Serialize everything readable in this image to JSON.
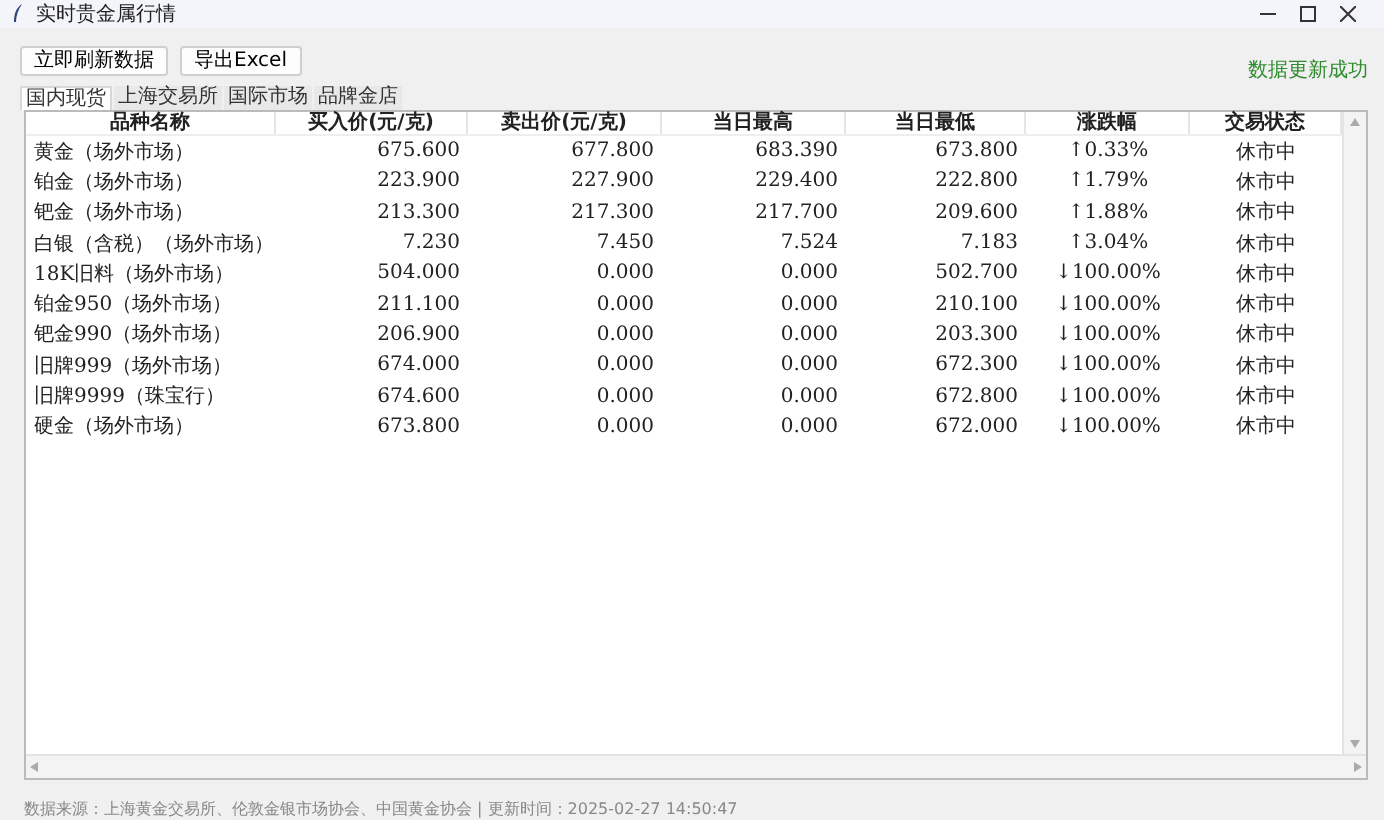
{
  "window": {
    "title": "实时贵金属行情"
  },
  "toolbar": {
    "buttons": [
      "立即刷新数据",
      "导出Excel"
    ],
    "status": "数据更新成功"
  },
  "tabs": [
    {
      "label": "国内现货",
      "selected": true
    },
    {
      "label": "上海交易所",
      "selected": false
    },
    {
      "label": "国际市场",
      "selected": false
    },
    {
      "label": "品牌金店",
      "selected": false
    }
  ],
  "table": {
    "columns": [
      "品种名称",
      "买入价(元/克)",
      "卖出价(元/克)",
      "当日最高",
      "当日最低",
      "涨跌幅",
      "交易状态"
    ],
    "rows": [
      [
        "黄金（场外市场）",
        "675.600",
        "677.800",
        "683.390",
        "673.800",
        "↑0.33%",
        "休市中"
      ],
      [
        "铂金（场外市场）",
        "223.900",
        "227.900",
        "229.400",
        "222.800",
        "↑1.79%",
        "休市中"
      ],
      [
        "钯金（场外市场）",
        "213.300",
        "217.300",
        "217.700",
        "209.600",
        "↑1.88%",
        "休市中"
      ],
      [
        "白银（含税）（场外市场）",
        "7.230",
        "7.450",
        "7.524",
        "7.183",
        "↑3.04%",
        "休市中"
      ],
      [
        "18K旧料（场外市场）",
        "504.000",
        "0.000",
        "0.000",
        "502.700",
        "↓100.00%",
        "休市中"
      ],
      [
        "铂金950（场外市场）",
        "211.100",
        "0.000",
        "0.000",
        "210.100",
        "↓100.00%",
        "休市中"
      ],
      [
        "钯金990（场外市场）",
        "206.900",
        "0.000",
        "0.000",
        "203.300",
        "↓100.00%",
        "休市中"
      ],
      [
        "旧牌999（场外市场）",
        "674.000",
        "0.000",
        "0.000",
        "672.300",
        "↓100.00%",
        "休市中"
      ],
      [
        "旧牌9999（珠宝行）",
        "674.600",
        "0.000",
        "0.000",
        "672.800",
        "↓100.00%",
        "休市中"
      ],
      [
        "硬金（场外市场）",
        "673.800",
        "0.000",
        "0.000",
        "672.000",
        "↓100.00%",
        "休市中"
      ]
    ]
  },
  "status_bar": "数据来源：上海黄金交易所、伦敦金银市场协会、中国黄金协会 | 更新时间：2025-02-27 14:50:47"
}
